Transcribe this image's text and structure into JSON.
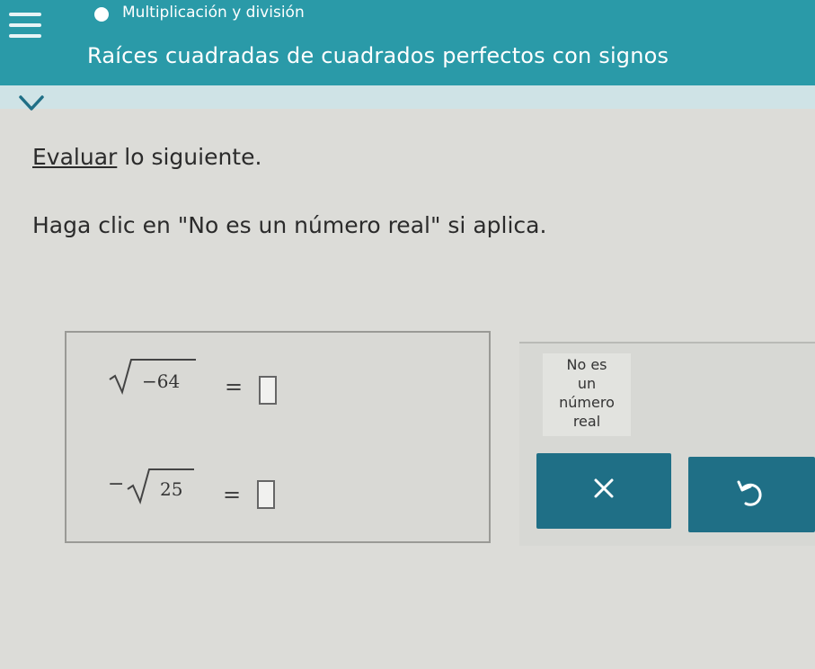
{
  "header": {
    "breadcrumb": "Multiplicación y división",
    "topic": "Raíces cuadradas de cuadrados perfectos con signos",
    "icons": {
      "menu": "menu-icon",
      "status": "dot-icon",
      "collapse": "chevron-down-icon"
    }
  },
  "instructions": {
    "line1_link": "Evaluar",
    "line1_rest": " lo siguiente.",
    "line2": "Haga clic en \"No es un número real\" si aplica."
  },
  "problems": [
    {
      "prefix": "",
      "radicand": "−64",
      "equals": "=",
      "answer": ""
    },
    {
      "prefix": "−",
      "radicand": "25",
      "equals": "=",
      "answer": ""
    }
  ],
  "panel": {
    "not_real_lines": [
      "No es",
      "un",
      "número",
      "real"
    ],
    "clear_icon": "x-icon",
    "undo_icon": "undo-icon"
  },
  "colors": {
    "header_bg": "#2a9aa8",
    "button_bg": "#1f6f86",
    "page_bg": "#dcdcd8"
  }
}
